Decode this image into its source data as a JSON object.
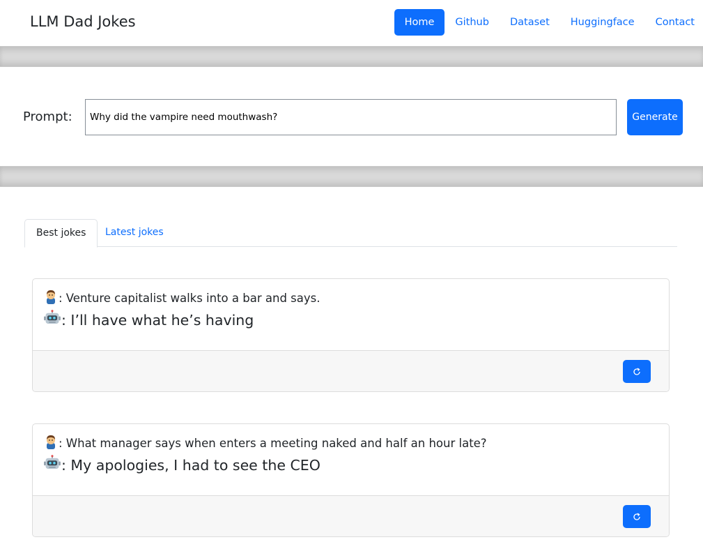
{
  "header": {
    "brand": "LLM Dad Jokes",
    "nav": [
      {
        "label": "Home",
        "active": true
      },
      {
        "label": "Github",
        "active": false
      },
      {
        "label": "Dataset",
        "active": false
      },
      {
        "label": "Huggingface",
        "active": false
      },
      {
        "label": "Contact",
        "active": false
      }
    ]
  },
  "prompt": {
    "label": "Prompt:",
    "value": "Why did the vampire need mouthwash?",
    "button_label": "Generate"
  },
  "tabs": [
    {
      "label": "Best jokes",
      "active": true
    },
    {
      "label": "Latest jokes",
      "active": false
    }
  ],
  "jokes": [
    {
      "question": ": Venture capitalist walks into a bar and says.",
      "answer": ": I’ll have what he’s having"
    },
    {
      "question": ": What manager says when enters a meeting naked and half an hour late?",
      "answer": ": My apologies, I had to see the CEO"
    }
  ],
  "icons": {
    "user": "man-emoji-icon",
    "bot": "robot-emoji-icon",
    "refresh": "refresh-icon"
  },
  "colors": {
    "primary": "#0d6efd",
    "band": "#d9d9d9"
  }
}
